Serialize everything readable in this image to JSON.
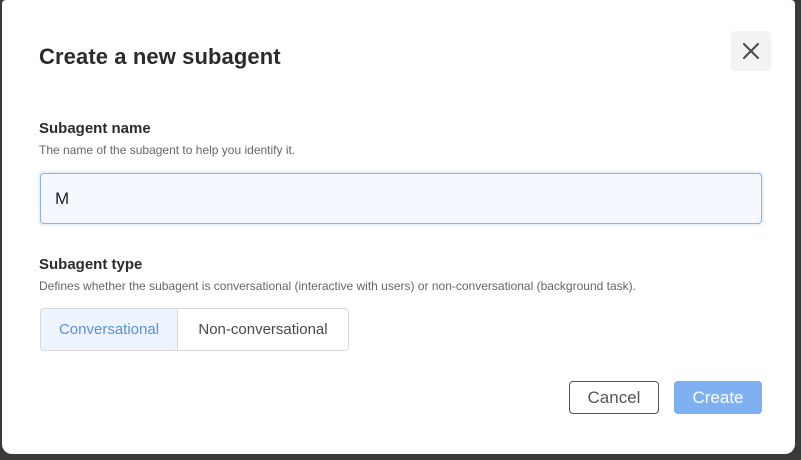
{
  "dialog": {
    "title": "Create a new subagent",
    "close_icon": "close-icon"
  },
  "name_field": {
    "label": "Subagent name",
    "help": "The name of the subagent to help you identify it.",
    "value": "M"
  },
  "type_field": {
    "label": "Subagent type",
    "help": "Defines whether the subagent is conversational (interactive with users) or non-conversational (background task).",
    "options": [
      "Conversational",
      "Non-conversational"
    ],
    "selected": "Conversational"
  },
  "actions": {
    "cancel_label": "Cancel",
    "create_label": "Create"
  },
  "colors": {
    "accent": "#5a8fd8",
    "primary_button": "#7fb0f2",
    "input_border": "#8fb2e3"
  }
}
